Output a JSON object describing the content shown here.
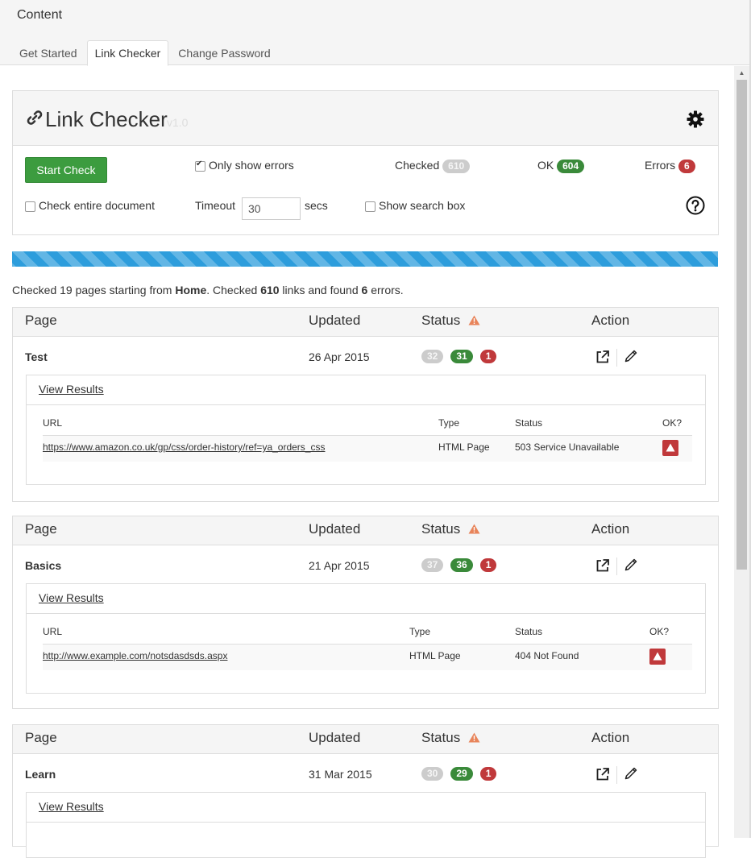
{
  "app": {
    "title": "Content"
  },
  "tabs": [
    {
      "label": "Get Started"
    },
    {
      "label": "Link Checker",
      "active": true
    },
    {
      "label": "Change Password"
    }
  ],
  "panel": {
    "title": "Link Checker",
    "version": "v1.0",
    "start_button": "Start Check",
    "only_show_errors": {
      "label": "Only show errors",
      "checked": true
    },
    "check_entire_document": {
      "label": "Check entire document",
      "checked": false
    },
    "show_search_box": {
      "label": "Show search box",
      "checked": false
    },
    "timeout": {
      "label": "Timeout",
      "value": "30",
      "unit": "secs"
    },
    "stats": {
      "checked_label": "Checked",
      "checked": "610",
      "ok_label": "OK",
      "ok": "604",
      "errors_label": "Errors",
      "errors": "6"
    }
  },
  "summary": {
    "prefix": "Checked 19 pages starting from ",
    "start_page": "Home",
    "mid": ". Checked ",
    "links": "610",
    "mid2": " links and found ",
    "errors": "6",
    "suffix": " errors."
  },
  "table_headers": {
    "page": "Page",
    "updated": "Updated",
    "status": "Status",
    "action": "Action"
  },
  "results_headers": {
    "url": "URL",
    "type": "Type",
    "status": "Status",
    "ok": "OK?"
  },
  "view_results_label": "View Results",
  "pages": [
    {
      "name": "Test",
      "updated": "26 Apr 2015",
      "counts": {
        "total": "32",
        "ok": "31",
        "errors": "1"
      },
      "results": [
        {
          "url": "https://www.amazon.co.uk/gp/css/order-history/ref=ya_orders_css",
          "type": "HTML Page",
          "status": "503 Service Unavailable"
        }
      ]
    },
    {
      "name": "Basics",
      "updated": "21 Apr 2015",
      "counts": {
        "total": "37",
        "ok": "36",
        "errors": "1"
      },
      "results": [
        {
          "url": "http://www.example.com/notsdasdsds.aspx",
          "type": "HTML Page",
          "status": "404 Not Found"
        }
      ]
    },
    {
      "name": "Learn",
      "updated": "31 Mar 2015",
      "counts": {
        "total": "30",
        "ok": "29",
        "errors": "1"
      },
      "results": []
    }
  ],
  "colors": {
    "green": "#3a8a3a",
    "red": "#c0393b",
    "progress": "#2d9ddc",
    "warning": "#e8845a"
  }
}
